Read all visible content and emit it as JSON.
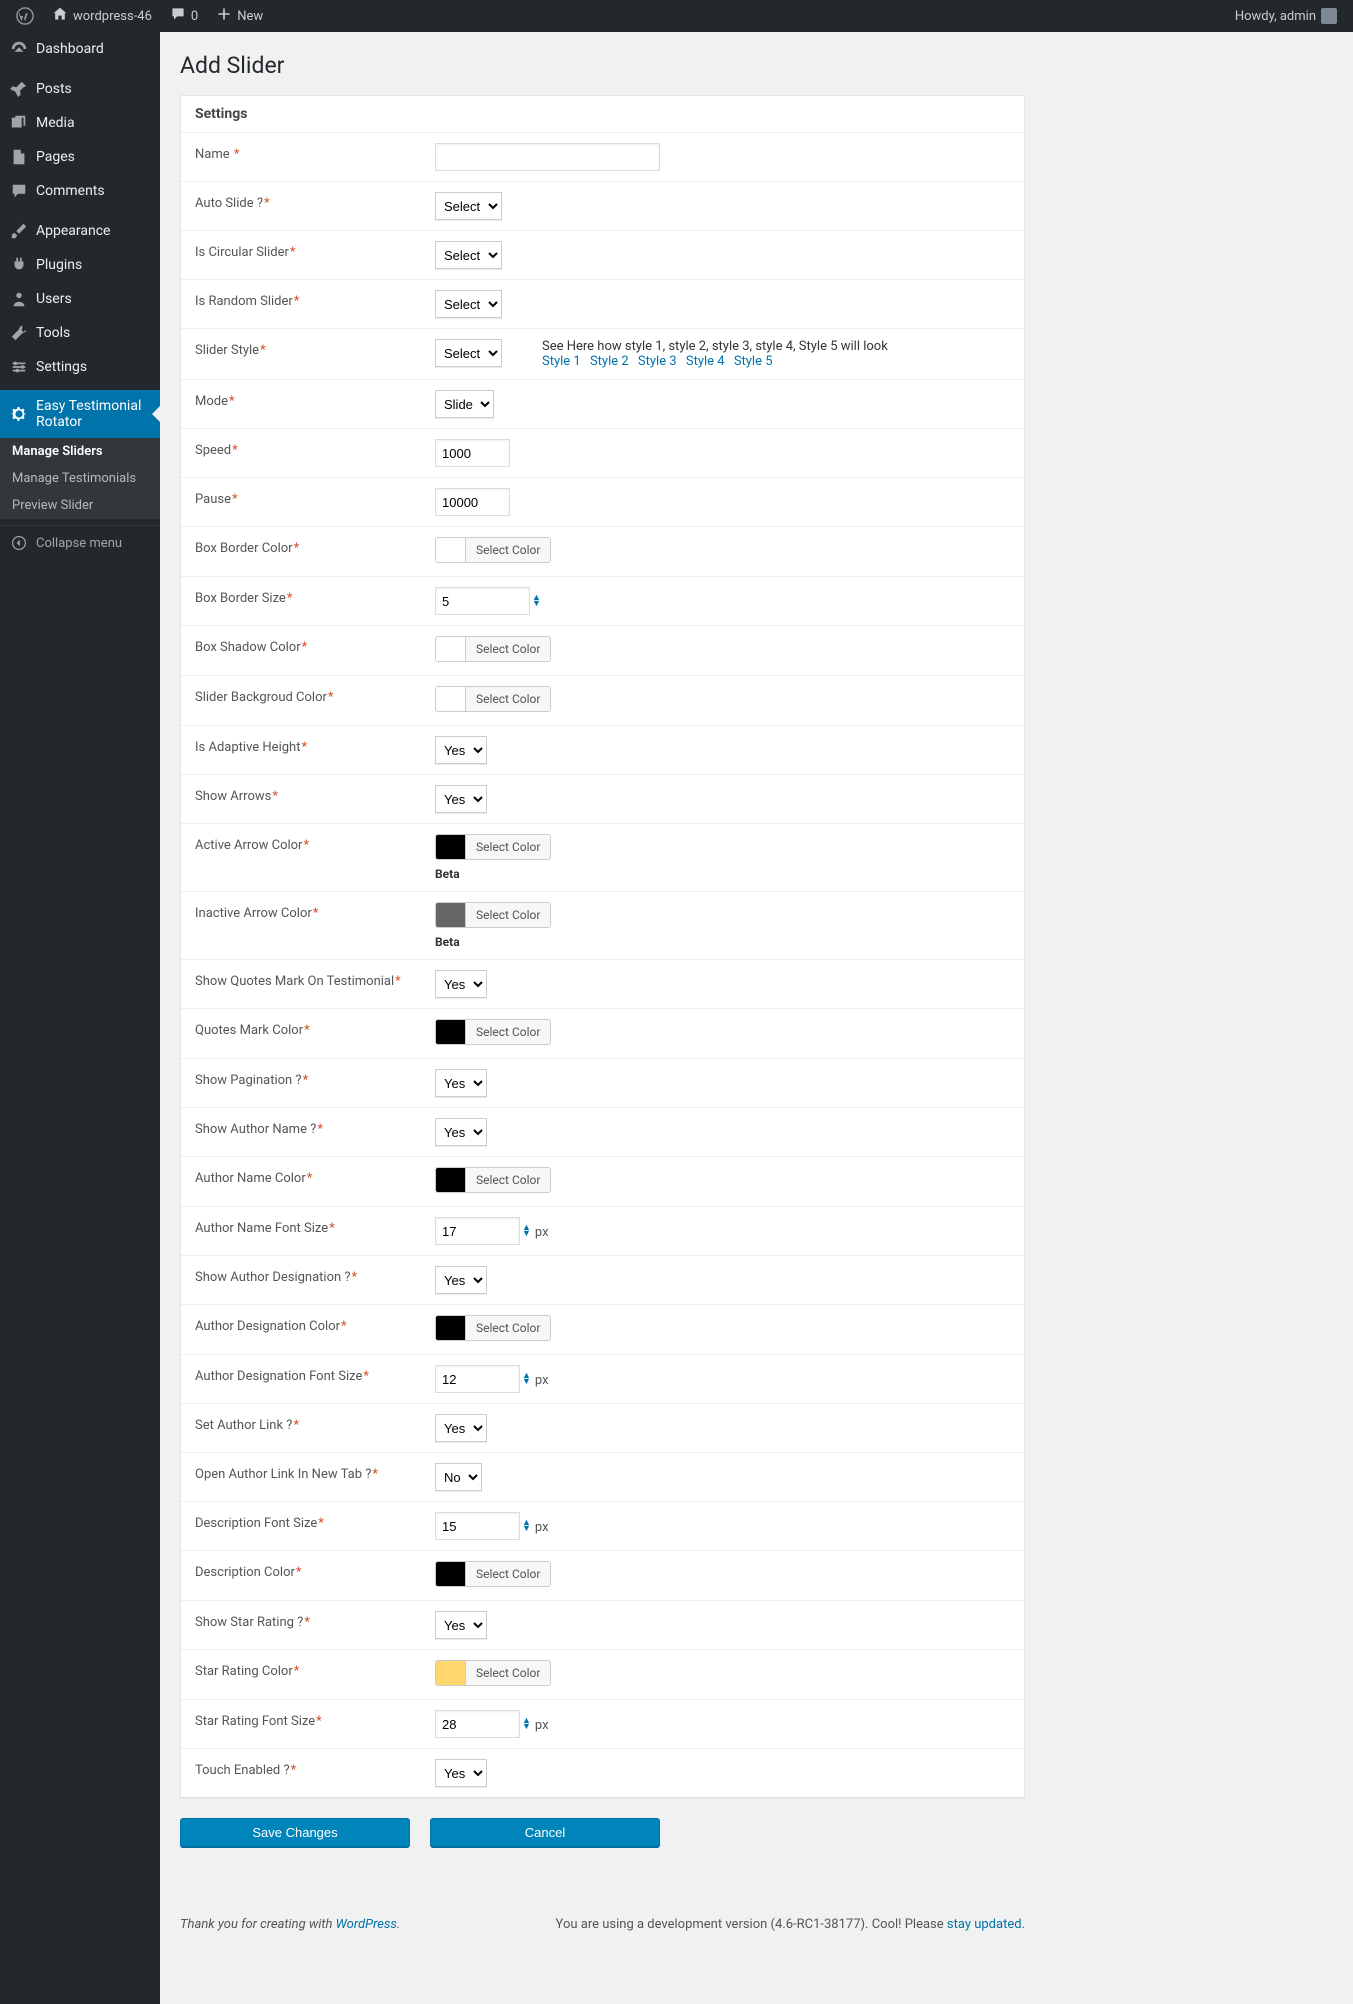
{
  "adminbar": {
    "site_name": "wordpress-46",
    "comments_count": "0",
    "new_label": "New",
    "howdy": "Howdy, admin"
  },
  "menu": {
    "dashboard": "Dashboard",
    "posts": "Posts",
    "media": "Media",
    "pages": "Pages",
    "comments": "Comments",
    "appearance": "Appearance",
    "plugins": "Plugins",
    "users": "Users",
    "tools": "Tools",
    "settings": "Settings",
    "easy_testimonial": "Easy Testimonial Rotator",
    "sub_manage_sliders": "Manage Sliders",
    "sub_manage_testimonials": "Manage Testimonials",
    "sub_preview_slider": "Preview Slider",
    "collapse": "Collapse menu"
  },
  "page": {
    "title": "Add Slider",
    "section_heading": "Settings"
  },
  "labels": {
    "name": "Name ",
    "auto_slide": "Auto Slide ?",
    "is_circular": "Is Circular Slider",
    "is_random": "Is Random Slider",
    "slider_style": "Slider Style",
    "mode": "Mode",
    "speed": "Speed",
    "pause": "Pause",
    "box_border_color": "Box Border Color",
    "box_border_size": "Box Border Size",
    "box_shadow_color": "Box Shadow Color",
    "slider_bg_color": "Slider Backgroud Color",
    "is_adaptive": "Is Adaptive Height",
    "show_arrows": "Show Arrows",
    "active_arrow_color": "Active Arrow Color",
    "inactive_arrow_color": "Inactive Arrow Color",
    "show_quotes": "Show Quotes Mark On Testimonial",
    "quotes_mark_color": "Quotes Mark Color",
    "show_pagination": "Show Pagination ?",
    "show_author_name": "Show Author Name ?",
    "author_name_color": "Author Name Color",
    "author_name_font_size": "Author Name Font Size",
    "show_author_designation": "Show Author Designation ?",
    "author_designation_color": "Author Designation Color",
    "author_designation_font_size": "Author Designation Font Size",
    "set_author_link": "Set Author Link ?",
    "open_author_link": "Open Author Link In New Tab ?",
    "description_font_size": "Description Font Size",
    "description_color": "Description Color",
    "show_star_rating": "Show Star Rating ?",
    "star_rating_color": "Star Rating Color",
    "star_rating_font_size": "Star Rating Font Size",
    "touch_enabled": "Touch Enabled ?"
  },
  "values": {
    "select_placeholder": "Select",
    "mode": "Slide",
    "speed": "1000",
    "pause": "10000",
    "box_border_size": "5",
    "yes": "Yes",
    "no": "No",
    "author_name_font_size": "17",
    "author_designation_font_size": "12",
    "description_font_size": "15",
    "star_rating_font_size": "28",
    "px": "px",
    "select_color": "Select Color",
    "beta": "Beta"
  },
  "colors": {
    "active_arrow": "#000000",
    "inactive_arrow": "#666666",
    "quotes_mark": "#000000",
    "author_name": "#000000",
    "author_designation": "#000000",
    "description": "#000000",
    "star_rating": "#ffd76e"
  },
  "style_help": {
    "intro": "See Here how style 1, style 2, style 3, style 4, Style 5 will look",
    "links": [
      "Style 1",
      "Style 2",
      "Style 3",
      "Style 4",
      "Style 5"
    ]
  },
  "buttons": {
    "save": "Save Changes",
    "cancel": "Cancel"
  },
  "footer": {
    "thank_prefix": "Thank you for creating with ",
    "wordpress": "WordPress",
    "version_prefix": "You are using a development version (4.6-RC1-38177). Cool! Please ",
    "stay_updated": "stay updated"
  }
}
